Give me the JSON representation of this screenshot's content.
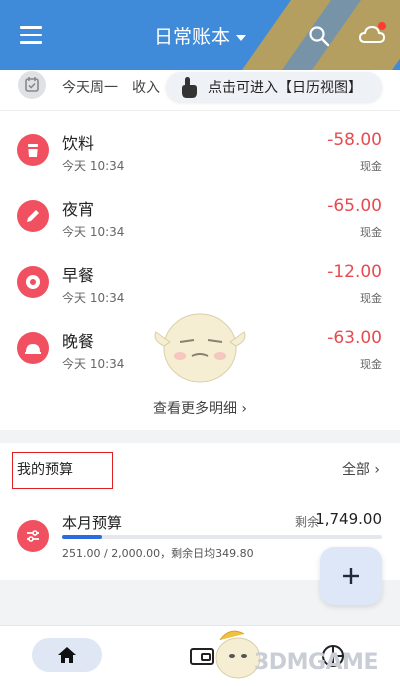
{
  "app_bar": {
    "title": "日常账本",
    "menu_icon": "menu-icon",
    "search_icon": "search-icon",
    "cloud_icon": "cloud-icon",
    "accent": "#3f8bd9"
  },
  "summary": {
    "day_text": "今天周一",
    "income_label": "收入",
    "tooltip_text": "点击可进入【日历视图】"
  },
  "transactions": [
    {
      "name": "饮料",
      "time": "今天 10:34",
      "amount": "-58.00",
      "account": "现金",
      "icon": "cup-icon"
    },
    {
      "name": "夜宵",
      "time": "今天 10:34",
      "amount": "-65.00",
      "account": "现金",
      "icon": "pencil-icon"
    },
    {
      "name": "早餐",
      "time": "今天 10:34",
      "amount": "-12.00",
      "account": "现金",
      "icon": "donut-icon"
    },
    {
      "name": "晚餐",
      "time": "今天 10:34",
      "amount": "-63.00",
      "account": "现金",
      "icon": "dish-icon"
    }
  ],
  "more_label": "查看更多明细 ›",
  "budget": {
    "section_title": "我的预算",
    "all_label": "全部 ›",
    "name": "本月预算",
    "remain_label": "剩余",
    "remain_value": "1,749.00",
    "detail": "251.00 / 2,000.00，剩余日均349.80",
    "progress_fraction": 0.1255
  },
  "fab_label": "+",
  "bottom_nav": {
    "home_icon": "home-icon",
    "wallet_icon": "wallet-icon",
    "chart_icon": "pie-chart-icon"
  },
  "watermark": "3DMGAME",
  "colors": {
    "expense_red": "#e84a4f",
    "icon_red": "#f0505f",
    "progress_blue": "#2b6de0",
    "annotation_box": "#e02020"
  }
}
